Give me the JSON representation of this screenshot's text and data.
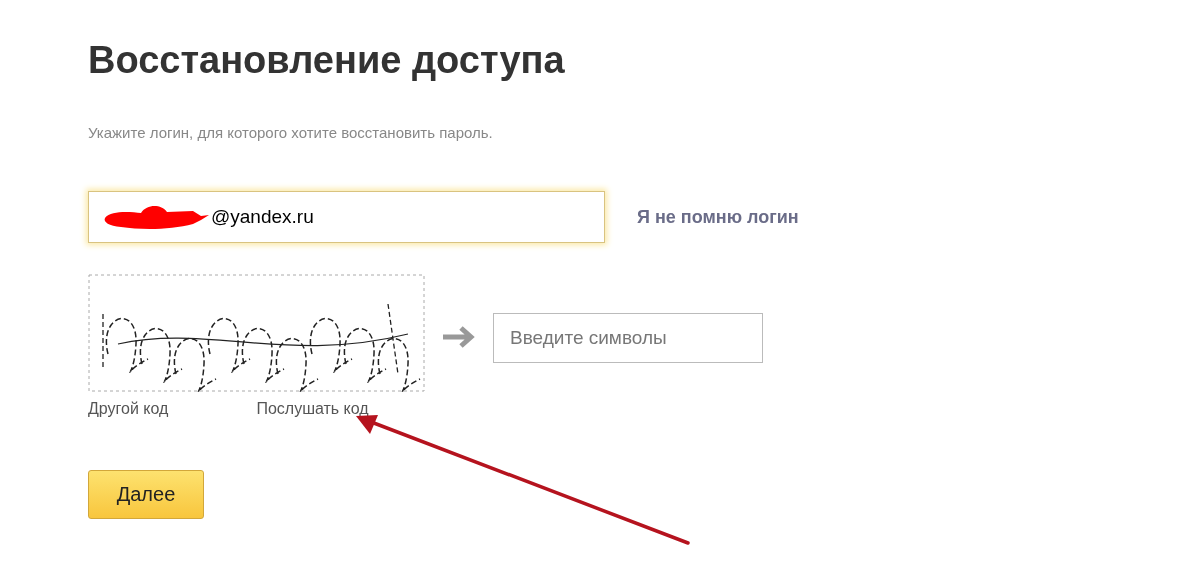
{
  "title": "Восстановление доступа",
  "instruction": "Укажите логин, для которого хотите восстановить пароль.",
  "login_field": {
    "value": "@yandex.ru",
    "redacted": true
  },
  "forgot_login_link": "Я не помню логин",
  "captcha": {
    "kind": "picture",
    "input_placeholder": "Введите символы",
    "other_code_link": "Другой код",
    "listen_code_link": "Послушать код"
  },
  "next_button": "Далее",
  "annotation_arrow": true
}
